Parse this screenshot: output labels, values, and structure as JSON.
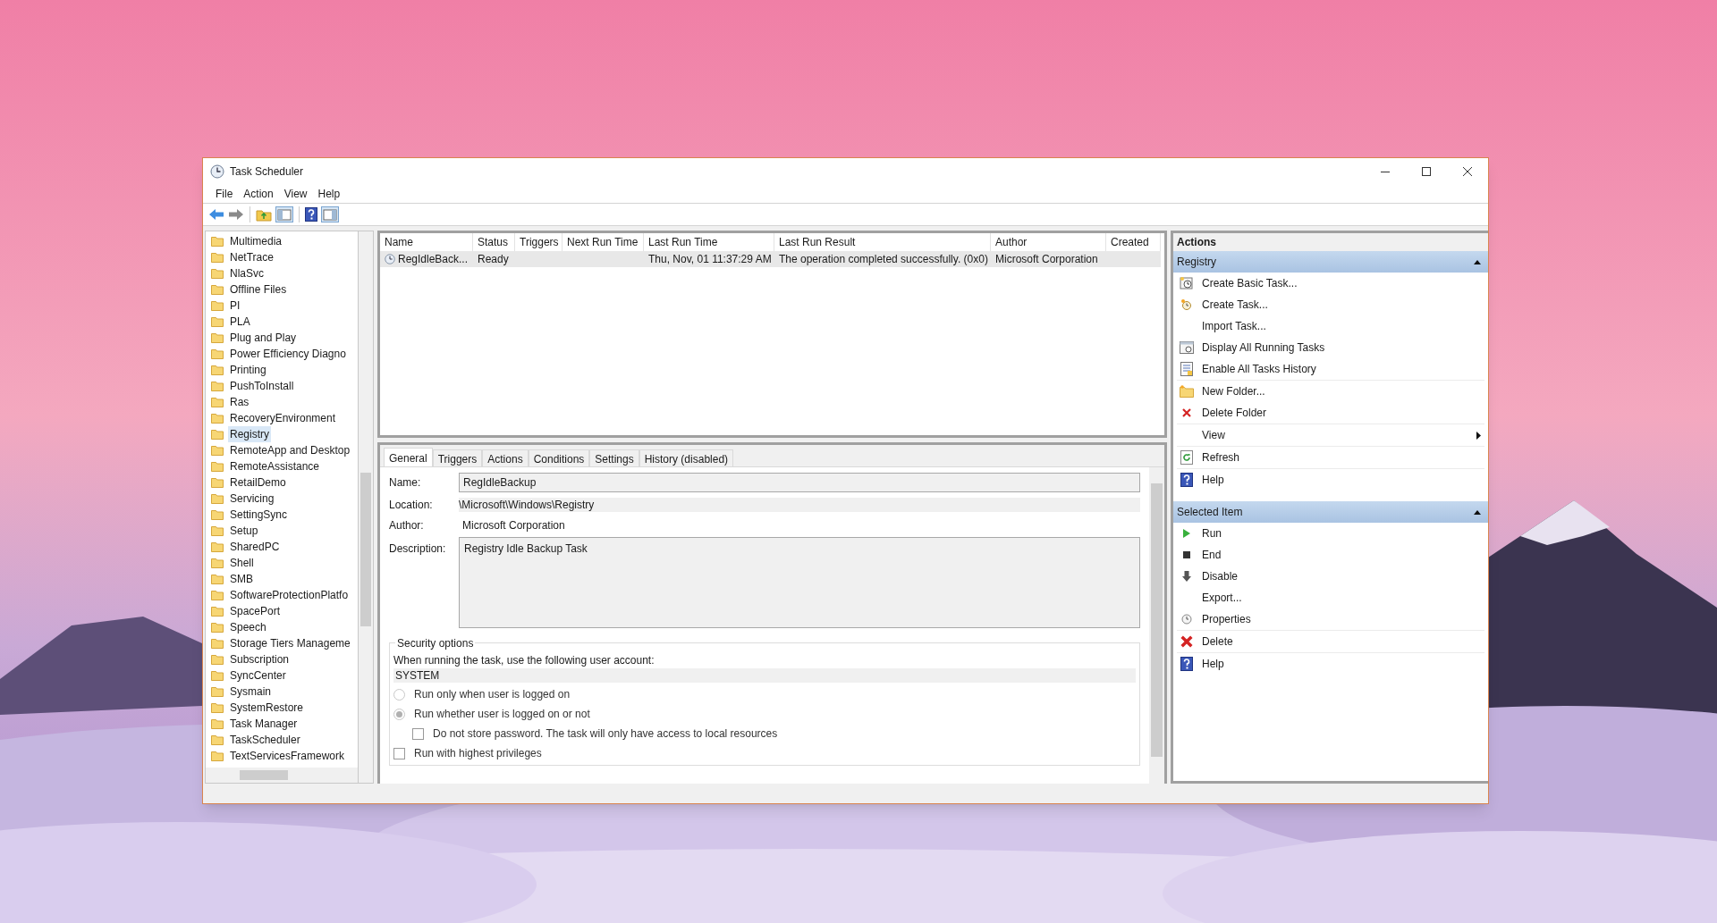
{
  "window": {
    "title": "Task Scheduler"
  },
  "menu": [
    "File",
    "Action",
    "View",
    "Help"
  ],
  "tree": {
    "items": [
      {
        "label": "Multimedia",
        "selected": false
      },
      {
        "label": "NetTrace",
        "selected": false
      },
      {
        "label": "NlaSvc",
        "selected": false
      },
      {
        "label": "Offline Files",
        "selected": false
      },
      {
        "label": "PI",
        "selected": false
      },
      {
        "label": "PLA",
        "selected": false
      },
      {
        "label": "Plug and Play",
        "selected": false
      },
      {
        "label": "Power Efficiency Diagno",
        "selected": false
      },
      {
        "label": "Printing",
        "selected": false
      },
      {
        "label": "PushToInstall",
        "selected": false
      },
      {
        "label": "Ras",
        "selected": false
      },
      {
        "label": "RecoveryEnvironment",
        "selected": false
      },
      {
        "label": "Registry",
        "selected": true
      },
      {
        "label": "RemoteApp and Desktop",
        "selected": false
      },
      {
        "label": "RemoteAssistance",
        "selected": false
      },
      {
        "label": "RetailDemo",
        "selected": false
      },
      {
        "label": "Servicing",
        "selected": false
      },
      {
        "label": "SettingSync",
        "selected": false
      },
      {
        "label": "Setup",
        "selected": false
      },
      {
        "label": "SharedPC",
        "selected": false
      },
      {
        "label": "Shell",
        "selected": false
      },
      {
        "label": "SMB",
        "selected": false
      },
      {
        "label": "SoftwareProtectionPlatfo",
        "selected": false
      },
      {
        "label": "SpacePort",
        "selected": false
      },
      {
        "label": "Speech",
        "selected": false
      },
      {
        "label": "Storage Tiers Manageme",
        "selected": false
      },
      {
        "label": "Subscription",
        "selected": false
      },
      {
        "label": "SyncCenter",
        "selected": false
      },
      {
        "label": "Sysmain",
        "selected": false
      },
      {
        "label": "SystemRestore",
        "selected": false
      },
      {
        "label": "Task Manager",
        "selected": false
      },
      {
        "label": "TaskScheduler",
        "selected": false
      },
      {
        "label": "TextServicesFramework",
        "selected": false
      }
    ]
  },
  "task_table": {
    "columns": [
      "Name",
      "Status",
      "Triggers",
      "Next Run Time",
      "Last Run Time",
      "Last Run Result",
      "Author",
      "Created"
    ],
    "rows": [
      {
        "selected": true,
        "cells": [
          "RegIdleBack...",
          "Ready",
          "",
          "",
          "Thu, Nov, 01 11:37:29 AM",
          "The operation completed successfully. (0x0)",
          "Microsoft Corporation",
          ""
        ]
      }
    ]
  },
  "detail_tabs": [
    {
      "label": "General",
      "selected": true
    },
    {
      "label": "Triggers",
      "selected": false
    },
    {
      "label": "Actions",
      "selected": false
    },
    {
      "label": "Conditions",
      "selected": false
    },
    {
      "label": "Settings",
      "selected": false
    },
    {
      "label": "History (disabled)",
      "selected": false
    }
  ],
  "general": {
    "name_label": "Name:",
    "name_value": "RegIdleBackup",
    "location_label": "Location:",
    "location_value": "\\Microsoft\\Windows\\Registry",
    "author_label": "Author:",
    "author_value": "Microsoft Corporation",
    "description_label": "Description:",
    "description_value": "Registry Idle Backup Task",
    "security": {
      "title": "Security options",
      "account_prompt": "When running the task, use the following user account:",
      "account": "SYSTEM",
      "options": [
        {
          "kind": "radio",
          "label": "Run only when user is logged on",
          "checked": false
        },
        {
          "kind": "radio",
          "label": "Run whether user is logged on or not",
          "checked": true,
          "children": [
            {
              "kind": "checkbox",
              "label": "Do not store password.  The task will only have access to local resources",
              "checked": false
            }
          ]
        },
        {
          "kind": "checkbox",
          "label": "Run with highest privileges",
          "checked": false
        }
      ]
    }
  },
  "actions": {
    "title": "Actions",
    "sections": [
      {
        "title": "Registry",
        "expanded": true,
        "groups": [
          {
            "items": [
              {
                "label": "Create Basic Task..."
              },
              {
                "label": "Create Task..."
              },
              {
                "label": "Import Task..."
              },
              {
                "label": "Display All Running Tasks"
              },
              {
                "label": "Enable All Tasks History"
              }
            ]
          },
          {
            "items": [
              {
                "label": "New Folder..."
              },
              {
                "label": "Delete Folder"
              }
            ]
          },
          {
            "items": [
              {
                "label": "View",
                "submenu": true
              }
            ]
          },
          {
            "items": [
              {
                "label": "Refresh"
              }
            ]
          },
          {
            "items": [
              {
                "label": "Help"
              }
            ]
          }
        ]
      },
      {
        "title": "Selected Item",
        "expanded": true,
        "groups": [
          {
            "items": [
              {
                "label": "Run"
              },
              {
                "label": "End"
              },
              {
                "label": "Disable"
              },
              {
                "label": "Export..."
              },
              {
                "label": "Properties"
              }
            ]
          },
          {
            "items": [
              {
                "label": "Delete"
              }
            ]
          },
          {
            "items": [
              {
                "label": "Help"
              }
            ]
          }
        ]
      }
    ]
  }
}
